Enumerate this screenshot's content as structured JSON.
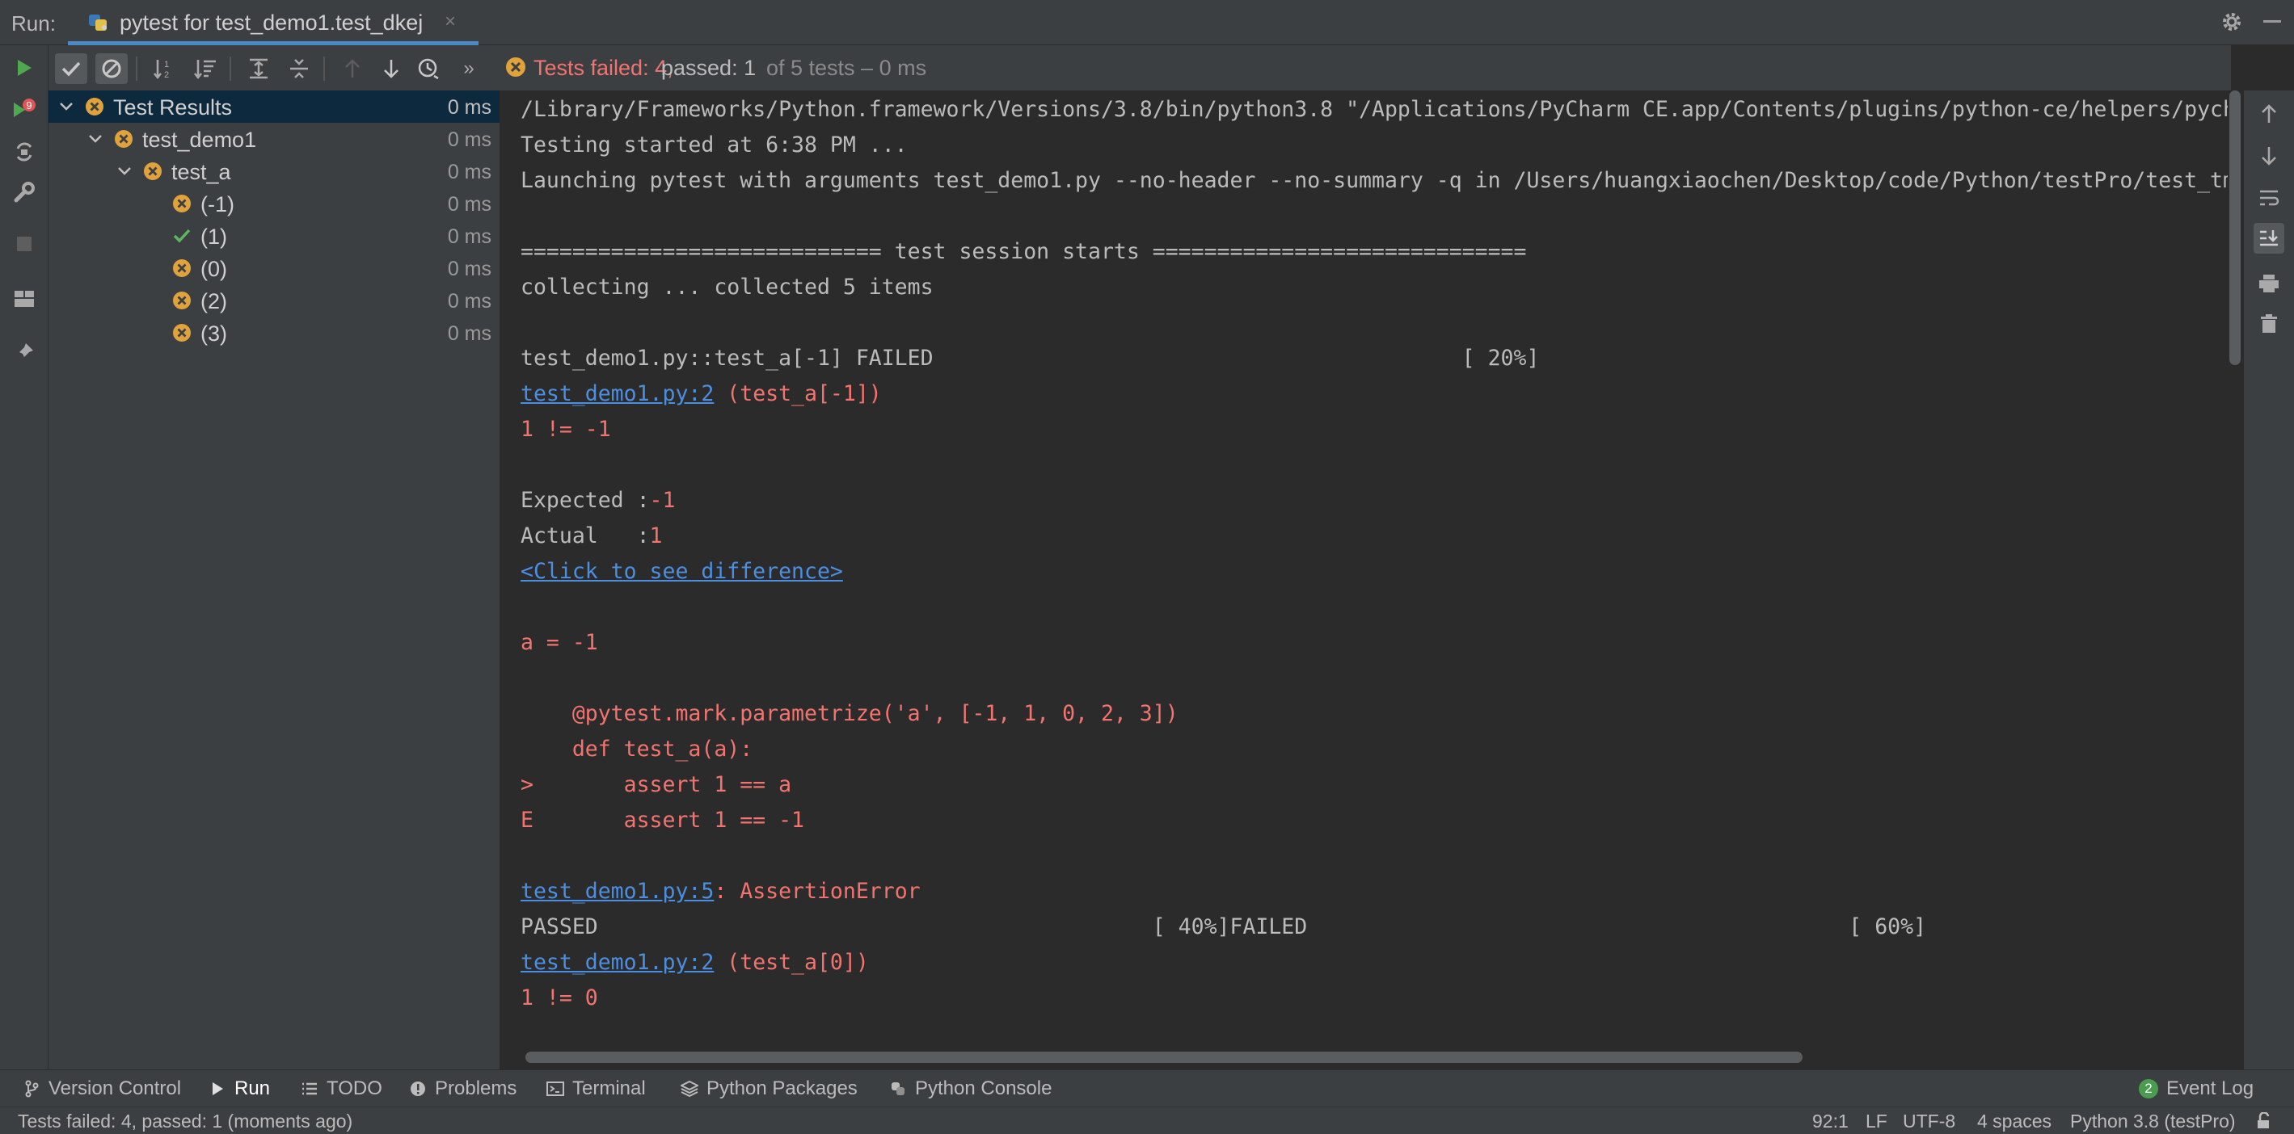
{
  "run_bar": {
    "label": "Run:",
    "tab_title": "pytest for test_demo1.test_dkej",
    "tab_close": "×"
  },
  "status": {
    "failed_text": "Tests failed: 4,",
    "passed_text": "passed: 1",
    "of_text": "of 5 tests – 0 ms"
  },
  "tree": {
    "items": [
      {
        "label": "Test Results",
        "time": "0 ms",
        "status": "failed",
        "level": 0,
        "expanded": true,
        "selected": true
      },
      {
        "label": "test_demo1",
        "time": "0 ms",
        "status": "failed",
        "level": 1,
        "expanded": true,
        "selected": false
      },
      {
        "label": "test_a",
        "time": "0 ms",
        "status": "failed",
        "level": 2,
        "expanded": true,
        "selected": false
      },
      {
        "label": "(-1)",
        "time": "0 ms",
        "status": "failed",
        "level": 3,
        "expanded": false,
        "selected": false
      },
      {
        "label": "(1)",
        "time": "0 ms",
        "status": "passed",
        "level": 3,
        "expanded": false,
        "selected": false
      },
      {
        "label": "(0)",
        "time": "0 ms",
        "status": "failed",
        "level": 3,
        "expanded": false,
        "selected": false
      },
      {
        "label": "(2)",
        "time": "0 ms",
        "status": "failed",
        "level": 3,
        "expanded": false,
        "selected": false
      },
      {
        "label": "(3)",
        "time": "0 ms",
        "status": "failed",
        "level": 3,
        "expanded": false,
        "selected": false
      }
    ]
  },
  "console": {
    "lines": [
      [
        {
          "t": "/Library/Frameworks/Python.framework/Versions/3.8/bin/python3.8 \"/Applications/PyCharm CE.app/Contents/plugins/python-ce/helpers/pycharm/_jb_pytest_runner.py\""
        }
      ],
      [
        {
          "t": "Testing started at 6:38 PM ..."
        }
      ],
      [
        {
          "t": "Launching pytest with arguments test_demo1.py --no-header --no-summary -q in /Users/huangxiaochen/Desktop/code/Python/testPro/test_tmp"
        }
      ],
      [],
      [
        {
          "t": "============================ test session starts ============================="
        }
      ],
      [
        {
          "t": "collecting ... collected 5 items"
        }
      ],
      [],
      [
        {
          "t": "test_demo1.py::test_a[-1] FAILED                                         [ 20%]"
        }
      ],
      [
        {
          "t": "test_demo1.py:2",
          "s": "link"
        },
        {
          "t": " (test_a[-1])",
          "s": "red"
        }
      ],
      [
        {
          "t": "1 != -1",
          "s": "red"
        }
      ],
      [],
      [
        {
          "t": "Expected :"
        },
        {
          "t": "-1",
          "s": "red"
        }
      ],
      [
        {
          "t": "Actual   :"
        },
        {
          "t": "1",
          "s": "red"
        }
      ],
      [
        {
          "t": "<Click to see difference>",
          "s": "link"
        }
      ],
      [],
      [
        {
          "t": "a = -1",
          "s": "red"
        }
      ],
      [],
      [
        {
          "t": "    @pytest.mark.parametrize('a', [-1, 1, 0, 2, 3])",
          "s": "red"
        }
      ],
      [
        {
          "t": "    def test_a(a):",
          "s": "red"
        }
      ],
      [
        {
          "t": ">       assert 1 == a",
          "s": "red"
        }
      ],
      [
        {
          "t": "E       assert 1 == -1",
          "s": "red"
        }
      ],
      [],
      [
        {
          "t": "test_demo1.py:5",
          "s": "link"
        },
        {
          "t": ": AssertionError",
          "s": "red"
        }
      ],
      [
        {
          "t": "PASSED                                           [ 40%]FAILED                                          [ 60%]"
        }
      ],
      [
        {
          "t": "test_demo1.py:2",
          "s": "link"
        },
        {
          "t": " (test_a[0])",
          "s": "red"
        }
      ],
      [
        {
          "t": "1 != 0",
          "s": "red"
        }
      ]
    ]
  },
  "bottom_tabs": {
    "version_control": "Version Control",
    "run": "Run",
    "todo": "TODO",
    "problems": "Problems",
    "terminal": "Terminal",
    "python_packages": "Python Packages",
    "python_console": "Python Console",
    "event_log": "Event Log",
    "event_count": "2"
  },
  "status_bar": {
    "message": "Tests failed: 4, passed: 1 (moments ago)",
    "position": "92:1",
    "line_sep": "LF",
    "encoding": "UTF-8",
    "indent": "4 spaces",
    "interpreter": "Python 3.8 (testPro)"
  },
  "colors": {
    "failed": "#f27470",
    "passed": "#5fb55f",
    "fail_icon": "#e0a33b",
    "link": "#4c8fe0",
    "accent": "#4a88c7"
  }
}
